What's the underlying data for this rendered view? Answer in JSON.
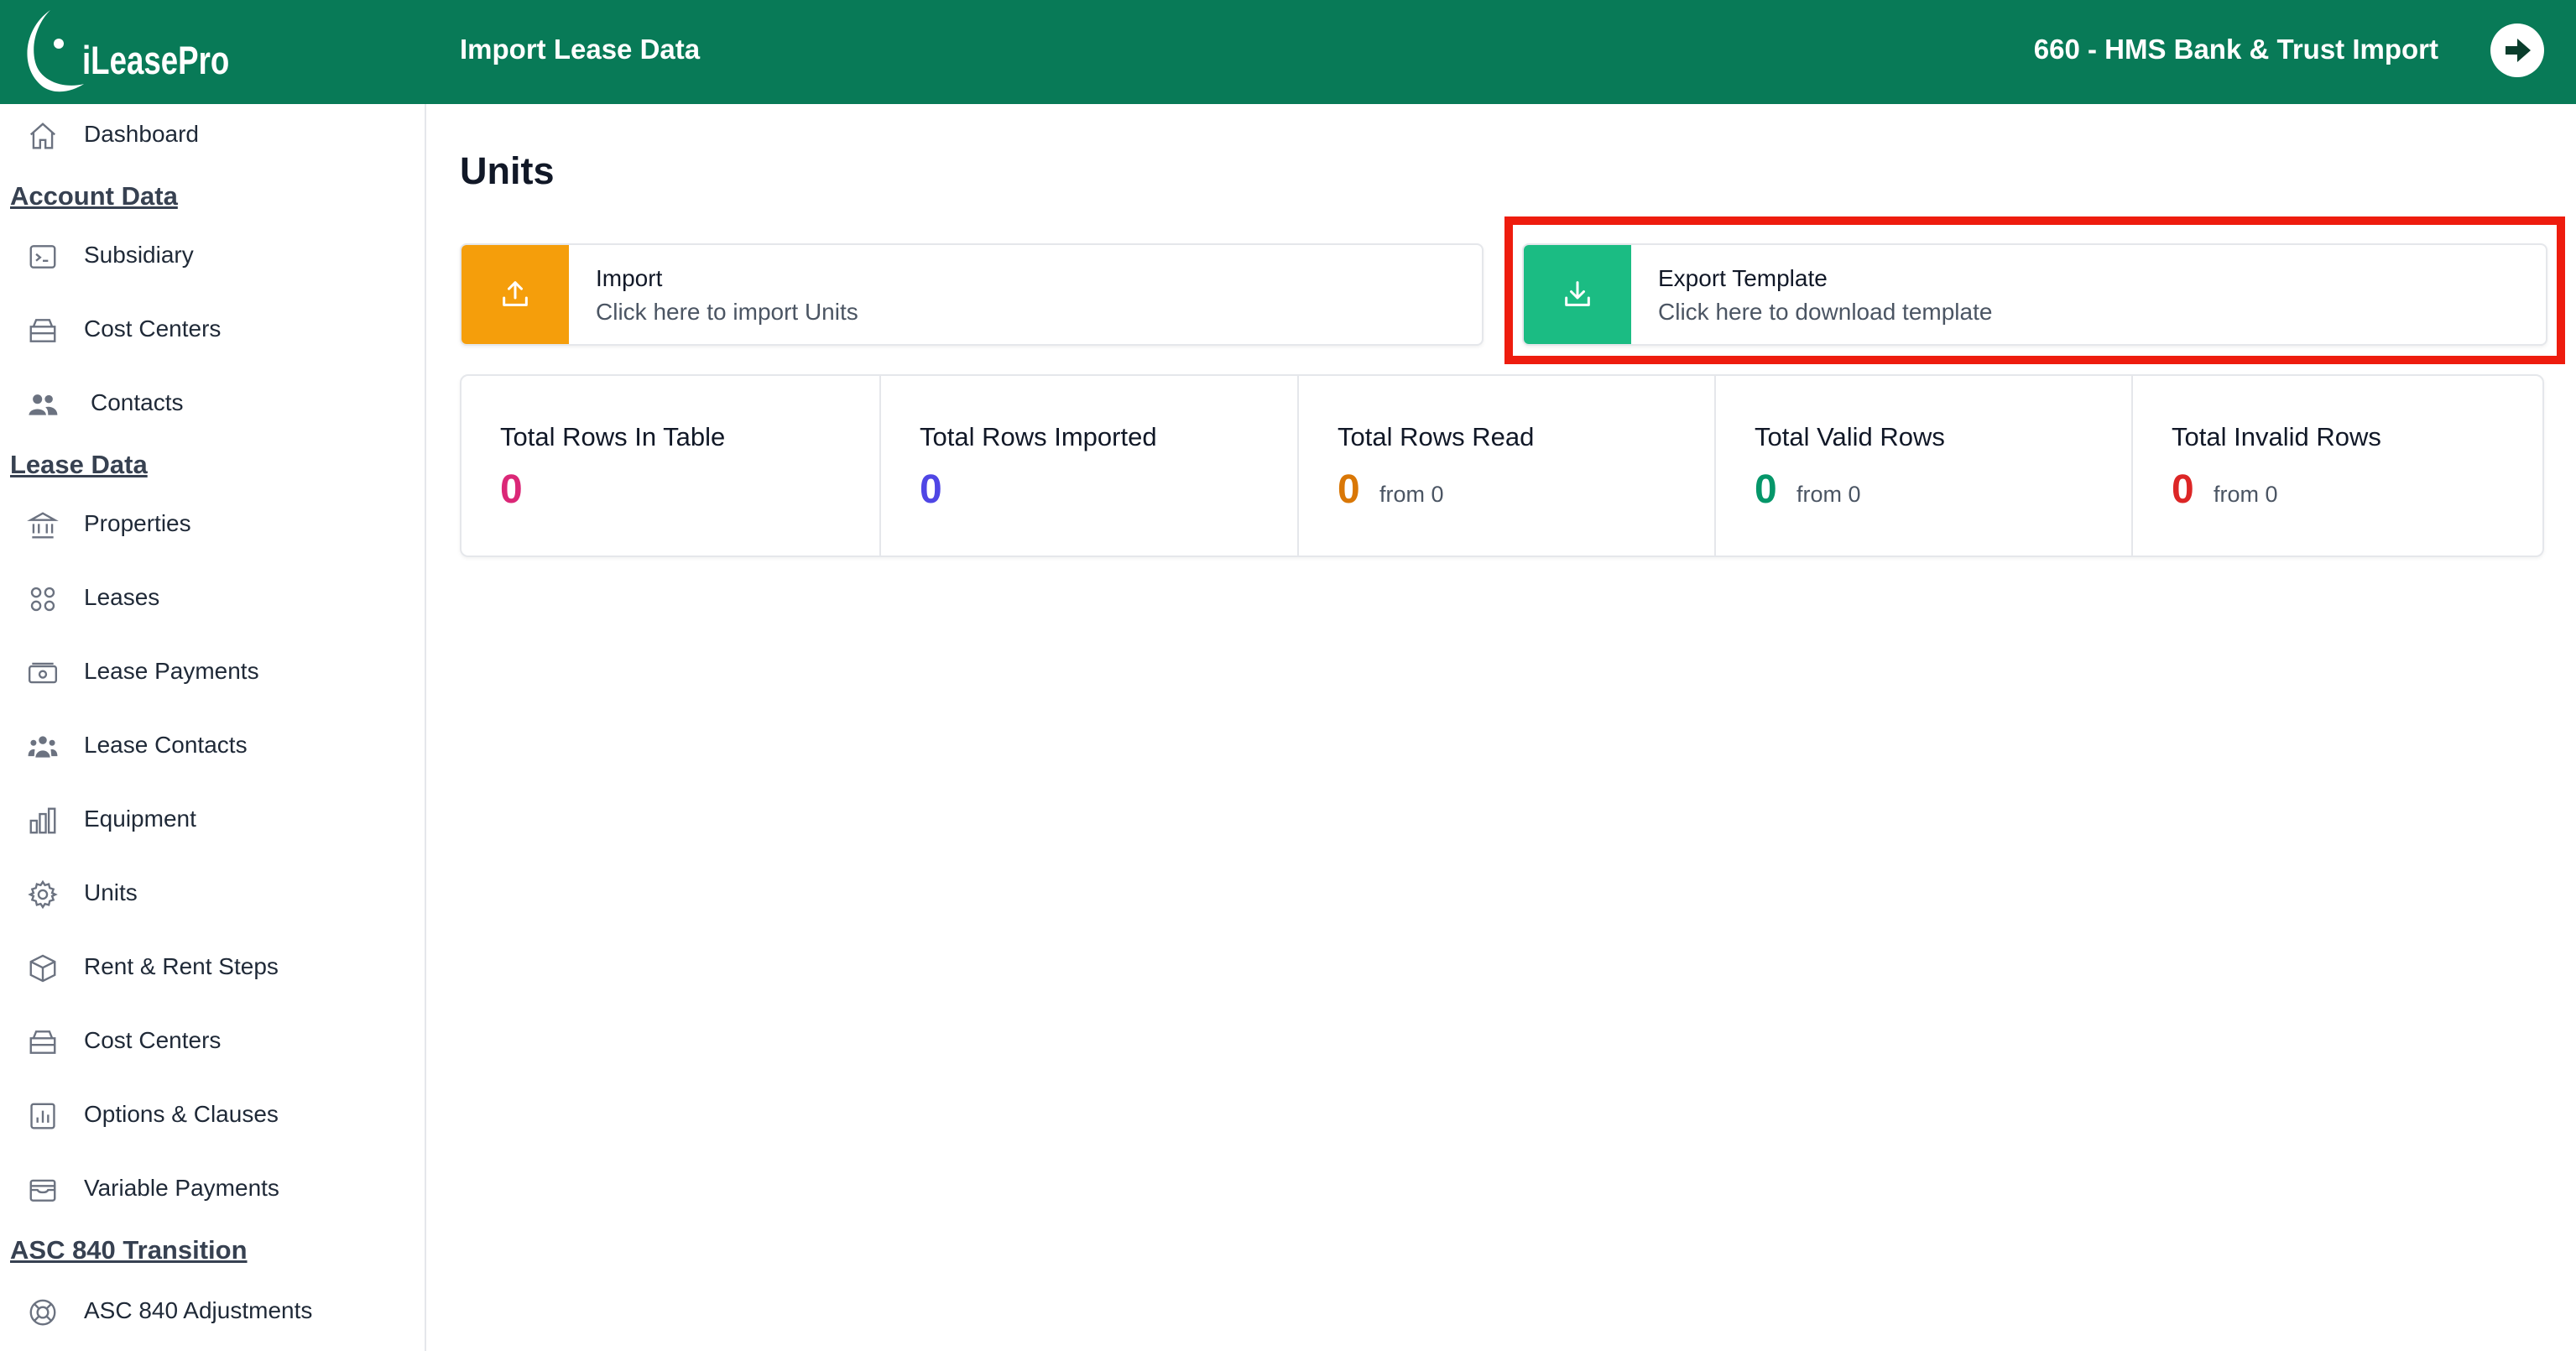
{
  "header": {
    "logo_text": "iLeasePro",
    "title": "Import Lease Data",
    "company": "660 - HMS Bank & Trust Import",
    "logout_icon": "arrow-right-circle-icon"
  },
  "sidebar": {
    "dashboard": {
      "label": "Dashboard",
      "icon": "home-icon"
    },
    "sections": {
      "account_data": "Account Data",
      "lease_data": "Lease Data",
      "asc840": "ASC 840 Transition"
    },
    "account_items": [
      {
        "label": "Subsidiary",
        "icon": "terminal-icon"
      },
      {
        "label": "Cost Centers",
        "icon": "inbox-stack-icon"
      },
      {
        "label": "Contacts",
        "icon": "users-icon"
      }
    ],
    "lease_items": [
      {
        "label": "Properties",
        "icon": "building-library-icon"
      },
      {
        "label": "Leases",
        "icon": "grid-circles-icon"
      },
      {
        "label": "Lease Payments",
        "icon": "banknotes-icon"
      },
      {
        "label": "Lease Contacts",
        "icon": "user-group-icon"
      },
      {
        "label": "Equipment",
        "icon": "chart-bar-icon"
      },
      {
        "label": "Units",
        "icon": "cog-icon"
      },
      {
        "label": "Rent & Rent Steps",
        "icon": "cube-icon"
      },
      {
        "label": "Cost Centers",
        "icon": "inbox-stack-icon"
      },
      {
        "label": "Options & Clauses",
        "icon": "presentation-chart-icon"
      },
      {
        "label": "Variable Payments",
        "icon": "wallet-icon"
      }
    ],
    "asc_items": [
      {
        "label": "ASC 840 Adjustments",
        "icon": "lifebuoy-icon"
      }
    ]
  },
  "main": {
    "page_title": "Units",
    "import_card": {
      "title": "Import",
      "subtitle": "Click here to import Units",
      "icon": "upload-icon",
      "color": "#f59e0b"
    },
    "export_card": {
      "title": "Export Template",
      "subtitle": "Click here to download template",
      "icon": "download-icon",
      "color": "#1bbc83"
    },
    "stats": [
      {
        "label": "Total Rows In Table",
        "value": "0",
        "color": "#db2777"
      },
      {
        "label": "Total Rows Imported",
        "value": "0",
        "color": "#4f46e5"
      },
      {
        "label": "Total Rows Read",
        "value": "0",
        "from": "from 0",
        "color": "#d97706"
      },
      {
        "label": "Total Valid Rows",
        "value": "0",
        "from": "from 0",
        "color": "#059669"
      },
      {
        "label": "Total Invalid Rows",
        "value": "0",
        "from": "from 0",
        "color": "#dc2626"
      }
    ]
  },
  "colors": {
    "header_bg": "#087a57",
    "highlight": "#ee1c0e"
  }
}
